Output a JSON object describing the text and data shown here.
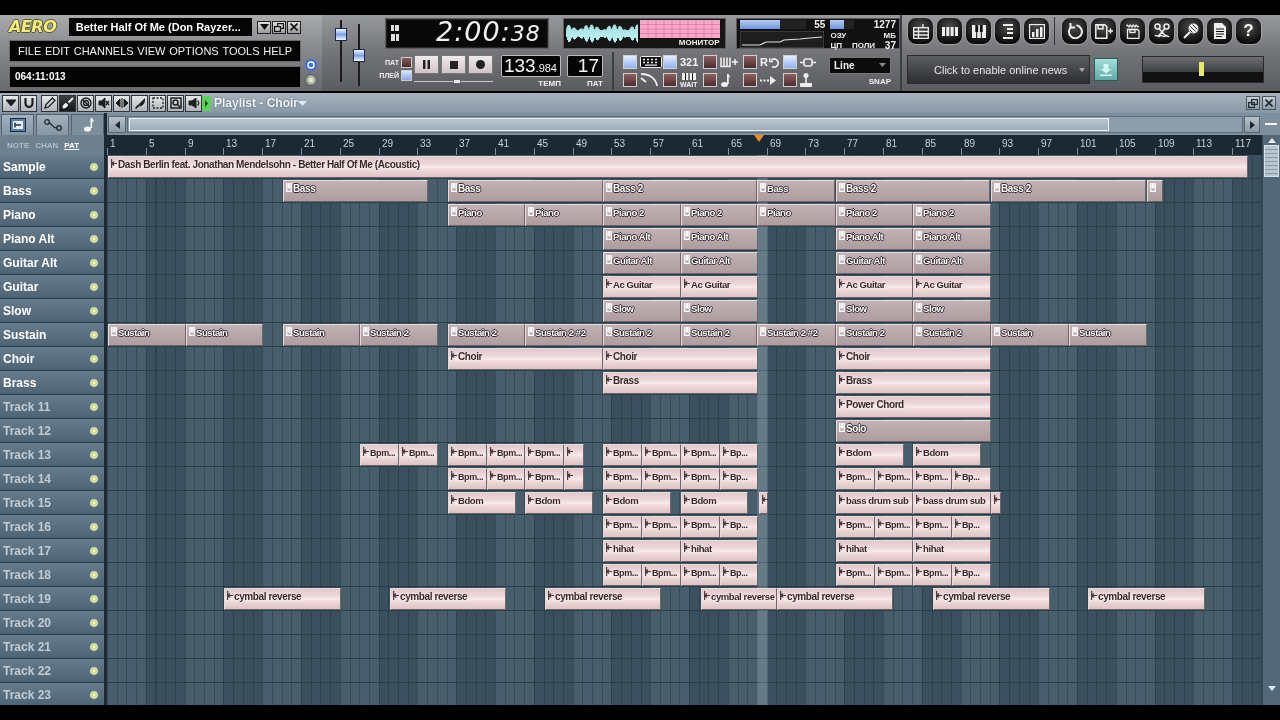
{
  "header": {
    "logo": "AERO",
    "title": "Better Half Of Me (Don Rayzer...",
    "window_buttons": [
      {
        "kind": "menu"
      },
      {
        "kind": "restore"
      },
      {
        "kind": "close"
      }
    ],
    "menu": [
      "FILE",
      "EDIT",
      "CHANNELS",
      "VIEW",
      "OPTIONS",
      "TOOLS",
      "HELP"
    ],
    "hint": "064:11:013"
  },
  "master": {
    "volume": {
      "level": 0.83
    },
    "pitch": {
      "level": 0.5
    }
  },
  "song_time": {
    "main": "2:00:",
    "seconds": "38"
  },
  "monitor": {
    "label": "МОНИТОР"
  },
  "performance": {
    "cpu": {
      "level": 0.6,
      "value": "55"
    },
    "memory": {
      "level": 0.55,
      "value": "1277",
      "label": "ОЗУ",
      "unit": "МБ"
    },
    "cpu_label": "ЦП",
    "poly": {
      "label": "ПОЛИ",
      "value": "37"
    }
  },
  "transport": {
    "modes": [
      {
        "label": "ПАТ",
        "selected": false
      },
      {
        "label": "ПЛЕЙ",
        "selected": true
      }
    ],
    "buttons": [
      {
        "kind": "pause"
      },
      {
        "kind": "stop"
      },
      {
        "kind": "record"
      }
    ],
    "position": {
      "level": 0.55
    },
    "tempo": {
      "whole": "133",
      "fraction": ".984",
      "label": "ТЕМП"
    },
    "pattern": {
      "value": "17",
      "label": "ПАТ"
    }
  },
  "recording": {
    "toggles": [
      {
        "kind": "typing-keyboard",
        "on": true
      },
      {
        "kind": "countdown",
        "on": true,
        "text": "321"
      },
      {
        "kind": "overdub",
        "on": false
      },
      {
        "kind": "loop",
        "on": false,
        "text": "R"
      },
      {
        "kind": "link",
        "on": true
      },
      {
        "kind": "metronome",
        "on": false
      },
      {
        "kind": "wait",
        "on": false,
        "text": "WAIT"
      },
      {
        "kind": "note",
        "on": false
      },
      {
        "kind": "step",
        "on": false
      },
      {
        "kind": "joystick",
        "on": false
      }
    ],
    "snap": {
      "value": "Line",
      "label": "SNAP"
    }
  },
  "shortcut_groups": [
    [
      {
        "kind": "playlist"
      },
      {
        "kind": "step-sequencer"
      },
      {
        "kind": "piano-roll"
      },
      {
        "kind": "browser"
      },
      {
        "kind": "mixer"
      }
    ],
    [
      {
        "kind": "revert"
      },
      {
        "kind": "save-new"
      },
      {
        "kind": "export"
      },
      {
        "kind": "sample-editor"
      },
      {
        "kind": "record-audio"
      },
      {
        "kind": "project-info"
      },
      {
        "kind": "help",
        "glyph": "?"
      }
    ]
  ],
  "news": {
    "text": "Click to enable online news"
  },
  "playlist": {
    "title": "Playlist - Choir",
    "tools": [
      {
        "kind": "menu",
        "selected": false
      },
      {
        "kind": "snap",
        "selected": false
      },
      {
        "kind": "draw",
        "selected": false
      },
      {
        "kind": "paint",
        "selected": true
      },
      {
        "kind": "delete",
        "selected": false
      },
      {
        "kind": "mute",
        "selected": false
      },
      {
        "kind": "slip",
        "selected": false
      },
      {
        "kind": "slice",
        "selected": false
      },
      {
        "kind": "select",
        "selected": false
      },
      {
        "kind": "zoom",
        "selected": false
      },
      {
        "kind": "playback",
        "selected": false
      }
    ],
    "tabs": [
      {
        "kind": "clips",
        "selected": false
      },
      {
        "kind": "automation",
        "selected": false
      },
      {
        "kind": "patterns",
        "selected": true
      }
    ],
    "filters": [
      {
        "label": "NOTE",
        "selected": false
      },
      {
        "label": "CHAN",
        "selected": false
      },
      {
        "label": "PAT",
        "selected": true
      }
    ],
    "ruler": [
      "1",
      "5",
      "9",
      "13",
      "17",
      "21",
      "25",
      "29",
      "33",
      "37",
      "41",
      "45",
      "49",
      "53",
      "57",
      "61",
      "65",
      "69",
      "73",
      "77",
      "81",
      "85",
      "89",
      "93",
      "97",
      "101",
      "105",
      "109",
      "113",
      "117"
    ],
    "tracks": [
      {
        "name": "Sample",
        "dimmed": false,
        "on": true,
        "clips": [
          {
            "kind": "audio",
            "label": "Dash Berlin feat. Jonathan Mendelsohn - Better Half Of Me (Acoustic)"
          }
        ]
      },
      {
        "name": "Bass",
        "dimmed": false,
        "on": true,
        "clips": [
          {
            "kind": "pattern",
            "label": "Bass"
          },
          {
            "kind": "pattern",
            "label": "Bass"
          },
          {
            "kind": "pattern",
            "label": "Bass 2"
          },
          {
            "kind": "pattern",
            "label": "Bass"
          },
          {
            "kind": "pattern",
            "label": "Bass 2"
          },
          {
            "kind": "pattern",
            "label": "Bass 2"
          },
          {
            "kind": "pattern"
          }
        ]
      },
      {
        "name": "Piano",
        "dimmed": false,
        "on": true,
        "clips": [
          {
            "kind": "pattern",
            "label": "Piano"
          },
          {
            "kind": "pattern",
            "label": "Piano"
          },
          {
            "kind": "pattern",
            "label": "Piano 2"
          },
          {
            "kind": "pattern",
            "label": "Piano 2"
          },
          {
            "kind": "pattern",
            "label": "Piano"
          },
          {
            "kind": "pattern",
            "label": "Piano 2"
          },
          {
            "kind": "pattern",
            "label": "Piano 2"
          }
        ]
      },
      {
        "name": "Piano Alt",
        "dimmed": false,
        "on": true,
        "clips": [
          {
            "kind": "pattern",
            "label": "Piano Alt"
          },
          {
            "kind": "pattern",
            "label": "Piano Alt"
          },
          {
            "kind": "pattern",
            "label": "Piano Alt"
          },
          {
            "kind": "pattern",
            "label": "Piano Alt"
          }
        ]
      },
      {
        "name": "Guitar Alt",
        "dimmed": false,
        "on": true,
        "clips": [
          {
            "kind": "pattern",
            "label": "Guitar Alt"
          },
          {
            "kind": "pattern",
            "label": "Guitar Alt"
          },
          {
            "kind": "pattern",
            "label": "Guitar Alt"
          },
          {
            "kind": "pattern",
            "label": "Guitar Alt"
          }
        ]
      },
      {
        "name": "Guitar",
        "dimmed": false,
        "on": true,
        "clips": [
          {
            "kind": "audio",
            "label": "Ac Guitar"
          },
          {
            "kind": "audio",
            "label": "Ac Guitar"
          },
          {
            "kind": "audio",
            "label": "Ac Guitar"
          },
          {
            "kind": "audio",
            "label": "Ac Guitar"
          }
        ]
      },
      {
        "name": "Slow",
        "dimmed": false,
        "on": true,
        "clips": [
          {
            "kind": "pattern",
            "label": "Slow"
          },
          {
            "kind": "pattern",
            "label": "Slow"
          },
          {
            "kind": "pattern",
            "label": "Slow"
          },
          {
            "kind": "pattern",
            "label": "Slow"
          }
        ]
      },
      {
        "name": "Sustain",
        "dimmed": false,
        "on": true,
        "clips": [
          {
            "kind": "pattern",
            "label": "Sustain"
          },
          {
            "kind": "pattern",
            "label": "Sustain"
          },
          {
            "kind": "pattern",
            "label": "Sustain"
          },
          {
            "kind": "pattern",
            "label": "Sustain 2"
          },
          {
            "kind": "pattern",
            "label": "Sustain 2"
          },
          {
            "kind": "pattern",
            "label": "Sustain 2 #2"
          },
          {
            "kind": "pattern",
            "label": "Sustain 2"
          },
          {
            "kind": "pattern",
            "label": "Sustain 2"
          },
          {
            "kind": "pattern",
            "label": "Sustain 2 #2"
          },
          {
            "kind": "pattern",
            "label": "Sustain 2"
          },
          {
            "kind": "pattern",
            "label": "Sustain 2"
          },
          {
            "kind": "pattern",
            "label": "Sustain"
          },
          {
            "kind": "pattern",
            "label": "Sustain"
          }
        ]
      },
      {
        "name": "Choir",
        "dimmed": false,
        "on": true,
        "clips": [
          {
            "kind": "audio",
            "label": "Choir"
          },
          {
            "kind": "audio",
            "label": "Choir"
          },
          {
            "kind": "audio",
            "label": "Choir"
          }
        ]
      },
      {
        "name": "Brass",
        "dimmed": false,
        "on": true,
        "clips": [
          {
            "kind": "audio",
            "label": "Brass"
          },
          {
            "kind": "audio",
            "label": "Brass"
          }
        ]
      },
      {
        "name": "Track 11",
        "dimmed": true,
        "on": true,
        "clips": [
          {
            "kind": "audio",
            "label": "Power Chord"
          }
        ]
      },
      {
        "name": "Track 12",
        "dimmed": true,
        "on": true,
        "clips": [
          {
            "kind": "pattern",
            "label": "Solo"
          }
        ]
      },
      {
        "name": "Track 13",
        "dimmed": true,
        "on": true,
        "clips": [
          {
            "kind": "audio",
            "label": "Bpm..."
          },
          {
            "kind": "audio",
            "label": "Bpm..."
          },
          {
            "kind": "audio",
            "label": "Bpm..."
          },
          {
            "kind": "audio",
            "label": "Bpm..."
          },
          {
            "kind": "audio",
            "label": "Bpm..."
          },
          {
            "kind": "audio"
          },
          {
            "kind": "audio",
            "label": "Bpm..."
          },
          {
            "kind": "audio",
            "label": "Bpm..."
          },
          {
            "kind": "audio",
            "label": "Bpm..."
          },
          {
            "kind": "audio",
            "label": "Bp..."
          },
          {
            "kind": "audio",
            "label": "Bdom"
          },
          {
            "kind": "audio",
            "label": "Bdom"
          }
        ]
      },
      {
        "name": "Track 14",
        "dimmed": true,
        "on": true,
        "clips": [
          {
            "kind": "audio",
            "label": "Bpm..."
          },
          {
            "kind": "audio",
            "label": "Bpm..."
          },
          {
            "kind": "audio",
            "label": "Bpm..."
          },
          {
            "kind": "audio"
          },
          {
            "kind": "audio",
            "label": "Bpm..."
          },
          {
            "kind": "audio",
            "label": "Bpm..."
          },
          {
            "kind": "audio",
            "label": "Bpm..."
          },
          {
            "kind": "audio",
            "label": "Bp..."
          },
          {
            "kind": "audio",
            "label": "Bpm..."
          },
          {
            "kind": "audio",
            "label": "Bpm..."
          },
          {
            "kind": "audio",
            "label": "Bpm..."
          },
          {
            "kind": "audio",
            "label": "Bp..."
          }
        ]
      },
      {
        "name": "Track 15",
        "dimmed": true,
        "on": true,
        "clips": [
          {
            "kind": "audio",
            "label": "Bdom"
          },
          {
            "kind": "audio",
            "label": "Bdom"
          },
          {
            "kind": "audio",
            "label": "Bdom"
          },
          {
            "kind": "audio",
            "label": "Bdom"
          },
          {
            "kind": "audio"
          },
          {
            "kind": "audio",
            "label": "bass drum sub"
          },
          {
            "kind": "audio",
            "label": "bass drum sub"
          },
          {
            "kind": "audio"
          }
        ]
      },
      {
        "name": "Track 16",
        "dimmed": true,
        "on": true,
        "clips": [
          {
            "kind": "audio",
            "label": "Bpm..."
          },
          {
            "kind": "audio",
            "label": "Bpm..."
          },
          {
            "kind": "audio",
            "label": "Bpm..."
          },
          {
            "kind": "audio",
            "label": "Bp..."
          },
          {
            "kind": "audio",
            "label": "Bpm..."
          },
          {
            "kind": "audio",
            "label": "Bpm..."
          },
          {
            "kind": "audio",
            "label": "Bpm..."
          },
          {
            "kind": "audio",
            "label": "Bp..."
          }
        ]
      },
      {
        "name": "Track 17",
        "dimmed": true,
        "on": true,
        "clips": [
          {
            "kind": "audio",
            "label": "hihat"
          },
          {
            "kind": "audio",
            "label": "hihat"
          },
          {
            "kind": "audio",
            "label": "hihat"
          },
          {
            "kind": "audio",
            "label": "hihat"
          }
        ]
      },
      {
        "name": "Track 18",
        "dimmed": true,
        "on": true,
        "clips": [
          {
            "kind": "audio",
            "label": "Bpm..."
          },
          {
            "kind": "audio",
            "label": "Bpm..."
          },
          {
            "kind": "audio",
            "label": "Bpm..."
          },
          {
            "kind": "audio",
            "label": "Bp..."
          },
          {
            "kind": "audio",
            "label": "Bpm..."
          },
          {
            "kind": "audio",
            "label": "Bpm..."
          },
          {
            "kind": "audio",
            "label": "Bpm..."
          },
          {
            "kind": "audio",
            "label": "Bp..."
          }
        ]
      },
      {
        "name": "Track 19",
        "dimmed": true,
        "on": true,
        "clips": [
          {
            "kind": "audio",
            "label": "cymbal reverse"
          },
          {
            "kind": "audio",
            "label": "cymbal reverse"
          },
          {
            "kind": "audio",
            "label": "cymbal reverse"
          },
          {
            "kind": "audio",
            "label": "cymbal reverse"
          },
          {
            "kind": "audio",
            "label": "cymbal reverse"
          },
          {
            "kind": "audio",
            "label": "cymbal reverse"
          },
          {
            "kind": "audio",
            "label": "cymbal reverse"
          }
        ]
      },
      {
        "name": "Track 20",
        "dimmed": true,
        "on": true
      },
      {
        "name": "Track 21",
        "dimmed": true,
        "on": true
      },
      {
        "name": "Track 22",
        "dimmed": true,
        "on": true
      },
      {
        "name": "Track 23",
        "dimmed": true,
        "on": true
      }
    ]
  }
}
